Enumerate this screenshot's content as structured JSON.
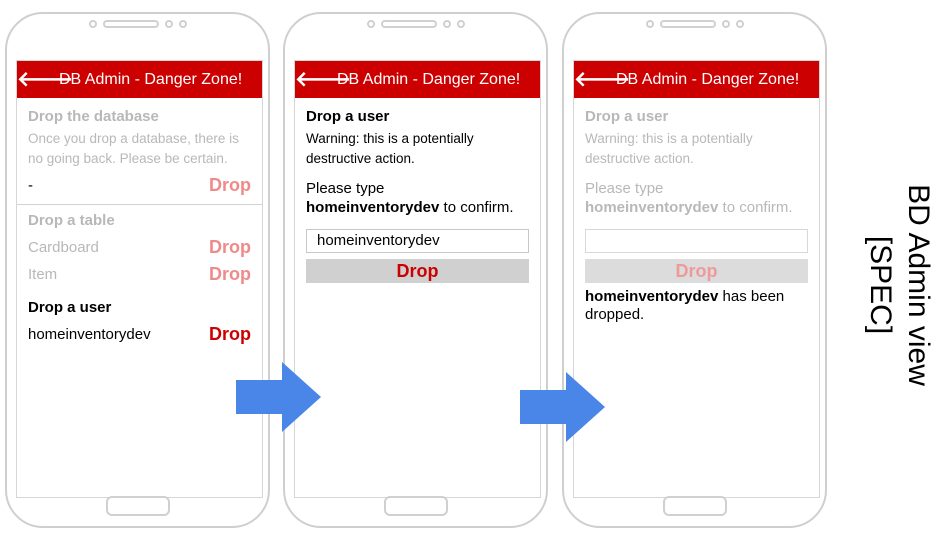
{
  "screen1": {
    "back_icon": "back-arrow-icon",
    "header_title": "DB Admin - Danger Zone!",
    "db_heading": "Drop the database",
    "db_warning": "Once you drop a database, there is no going back. Please be certain.",
    "db_name": "-",
    "db_drop": "Drop",
    "table_heading": "Drop a table",
    "tables": [
      {
        "name": "Cardboard",
        "drop": "Drop"
      },
      {
        "name": "Item",
        "drop": "Drop"
      }
    ],
    "user_heading": "Drop a user",
    "user_name": "homeinventorydev",
    "user_drop": "Drop"
  },
  "screen2": {
    "header_title": "DB Admin - Danger Zone!",
    "heading": "Drop a user",
    "warning": "Warning: this is a potentially destructive action.",
    "prompt_prefix": "Please type",
    "prompt_name": "homeinventorydev",
    "prompt_suffix": "to confirm.",
    "input_value": "homeinventorydev",
    "button": "Drop"
  },
  "screen3": {
    "header_title": "DB Admin - Danger Zone!",
    "heading": "Drop a user",
    "warning": "Warning: this is a potentially destructive action.",
    "prompt_prefix": "Please type",
    "prompt_name": "homeinventorydev",
    "prompt_suffix": "to confirm.",
    "input_value": "",
    "button": "Drop",
    "result_name": "homeinventorydev",
    "result_suffix": "has been dropped."
  },
  "side_label": {
    "line1": "BD Admin view",
    "line2": "[SPEC]"
  },
  "colors": {
    "header": "#cc0000",
    "arrow": "#4a86e8",
    "drop_active": "#cc0000",
    "drop_faded": "#ef8a8a"
  }
}
